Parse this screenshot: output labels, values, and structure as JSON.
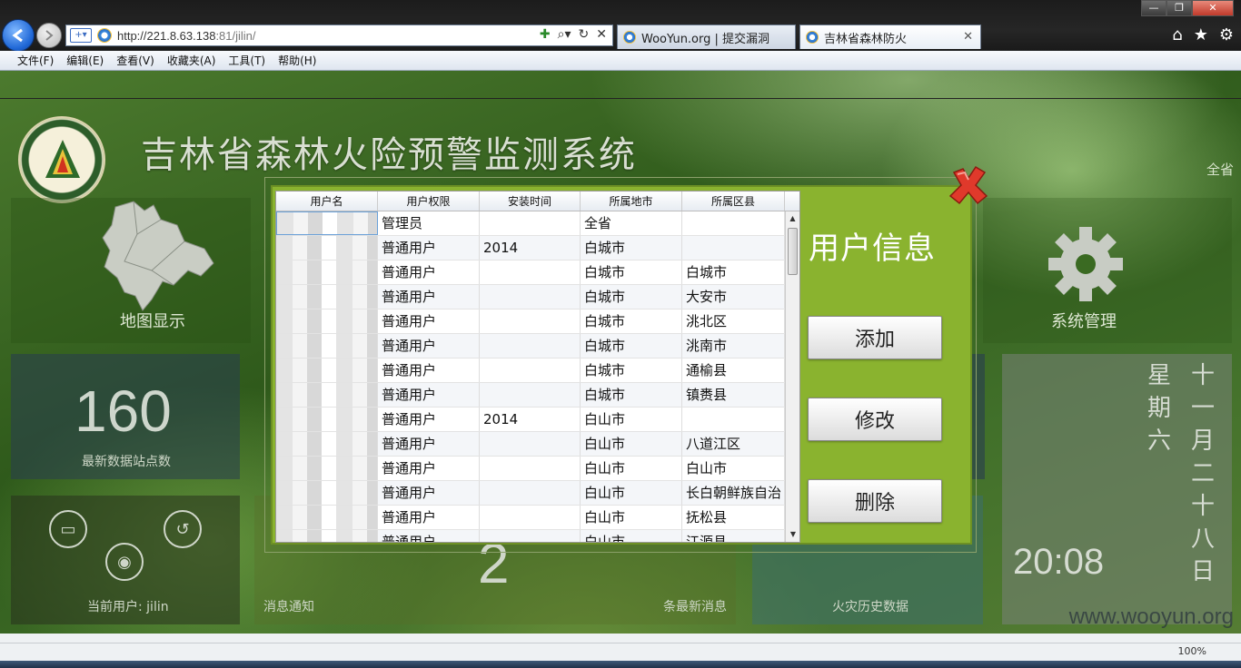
{
  "browser": {
    "url_host": "http://221.8.63.138",
    "url_rest": ":81/jilin/",
    "tabs": [
      {
        "label": "WooYun.org | 提交漏洞"
      },
      {
        "label": "吉林省森林防火"
      }
    ],
    "menu": [
      "文件(F)",
      "编辑(E)",
      "查看(V)",
      "收藏夹(A)",
      "工具(T)",
      "帮助(H)"
    ],
    "zoom": "100%"
  },
  "site": {
    "title": "吉林省森林火险预警监测系统",
    "region_label": "全省"
  },
  "tiles": {
    "map": "地图显示",
    "system": "系统管理",
    "stations_count": "160",
    "stations_label": "最新数据站点数",
    "current_user": "当前用户: jilin",
    "messages_label": "消息通知",
    "messages_count": "2",
    "messages_suffix": "条最新消息",
    "fire_history": "火灾历史数据",
    "weekday": "星期六",
    "lunar_date": "十一月二十八日",
    "clock": "20:08"
  },
  "dialog": {
    "title": "用户信息",
    "buttons": {
      "add": "添加",
      "edit": "修改",
      "delete": "删除"
    },
    "columns": [
      "用户名",
      "用户权限",
      "安装时间",
      "所属地市",
      "所属区县"
    ],
    "rows": [
      {
        "role": "管理员",
        "time": "",
        "city": "全省",
        "county": ""
      },
      {
        "role": "普通用户",
        "time": "2014",
        "city": "白城市",
        "county": ""
      },
      {
        "role": "普通用户",
        "time": "",
        "city": "白城市",
        "county": "白城市"
      },
      {
        "role": "普通用户",
        "time": "",
        "city": "白城市",
        "county": "大安市"
      },
      {
        "role": "普通用户",
        "time": "",
        "city": "白城市",
        "county": "洮北区"
      },
      {
        "role": "普通用户",
        "time": "",
        "city": "白城市",
        "county": "洮南市"
      },
      {
        "role": "普通用户",
        "time": "",
        "city": "白城市",
        "county": "通榆县"
      },
      {
        "role": "普通用户",
        "time": "",
        "city": "白城市",
        "county": "镇赉县"
      },
      {
        "role": "普通用户",
        "time": "2014",
        "city": "白山市",
        "county": ""
      },
      {
        "role": "普通用户",
        "time": "",
        "city": "白山市",
        "county": "八道江区"
      },
      {
        "role": "普通用户",
        "time": "",
        "city": "白山市",
        "county": "白山市"
      },
      {
        "role": "普通用户",
        "time": "",
        "city": "白山市",
        "county": "长白朝鲜族自治"
      },
      {
        "role": "普通用户",
        "time": "",
        "city": "白山市",
        "county": "抚松县"
      },
      {
        "role": "普通用户",
        "time": "",
        "city": "白山市",
        "county": "江源县"
      }
    ]
  },
  "watermark": "www.wooyun.org"
}
